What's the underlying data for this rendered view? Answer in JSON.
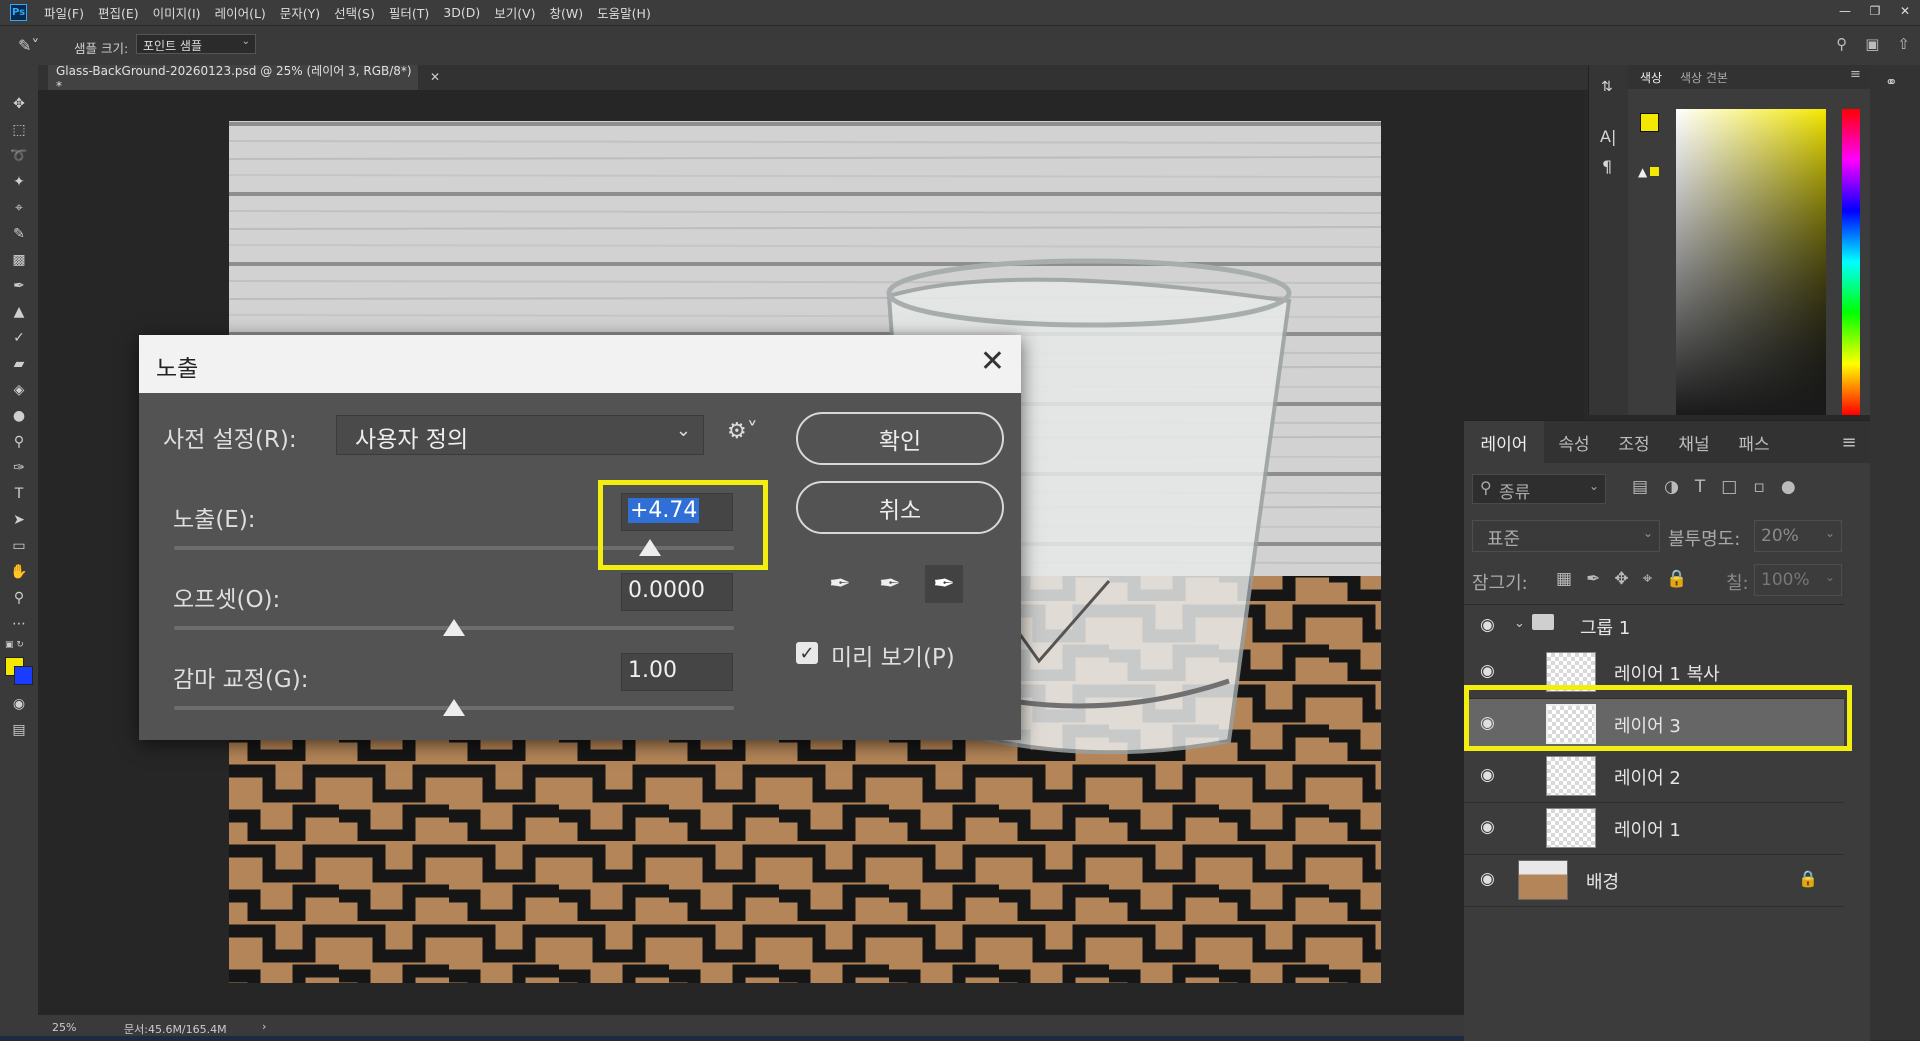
{
  "menu": {
    "items": [
      "파일(F)",
      "편집(E)",
      "이미지(I)",
      "레이어(L)",
      "문자(Y)",
      "선택(S)",
      "필터(T)",
      "3D(D)",
      "보기(V)",
      "창(W)",
      "도움말(H)"
    ]
  },
  "options_bar": {
    "sample_size_label": "샘플 크기:",
    "sample_size_value": "포인트 샘플"
  },
  "document": {
    "tab_title": "Glass-BackGround-20260123.psd @ 25% (레이어 3, RGB/8*) *",
    "zoom": "25%",
    "doc_size": "문서:45.6M/165.4M"
  },
  "dialog": {
    "title": "노출",
    "preset_label": "사전 설정(R):",
    "preset_value": "사용자 정의",
    "exposure_label": "노출(E):",
    "exposure_value": "+4.74",
    "exposure_slider_fraction": 0.85,
    "offset_label": "오프셋(O):",
    "offset_value": "0.0000",
    "offset_slider_fraction": 0.5,
    "gamma_label": "감마 교정(G):",
    "gamma_value": "1.00",
    "gamma_slider_fraction": 0.5,
    "ok_label": "확인",
    "cancel_label": "취소",
    "preview_label": "미리 보기(P)",
    "preview_checked": true
  },
  "color_panel": {
    "tabs": [
      "색상",
      "색상 견본"
    ],
    "foreground": "#f5e800",
    "background": "#1a3cff"
  },
  "layers_panel": {
    "tabs": [
      "레이어",
      "속성",
      "조정",
      "채널",
      "패스"
    ],
    "filter_placeholder": "종류",
    "blend_mode": "표준",
    "opacity_label": "불투명도:",
    "opacity_value": "20%",
    "lock_label": "잠그기:",
    "fill_label": "칠:",
    "fill_value": "100%",
    "layers": [
      {
        "name": "그룹 1",
        "type": "group"
      },
      {
        "name": "레이어 1 복사",
        "type": "layer"
      },
      {
        "name": "레이어 3",
        "type": "layer",
        "selected": true
      },
      {
        "name": "레이어 2",
        "type": "layer"
      },
      {
        "name": "레이어 1",
        "type": "layer"
      },
      {
        "name": "배경",
        "type": "background",
        "locked": true
      }
    ]
  },
  "highlight_color": "#f2ee10"
}
